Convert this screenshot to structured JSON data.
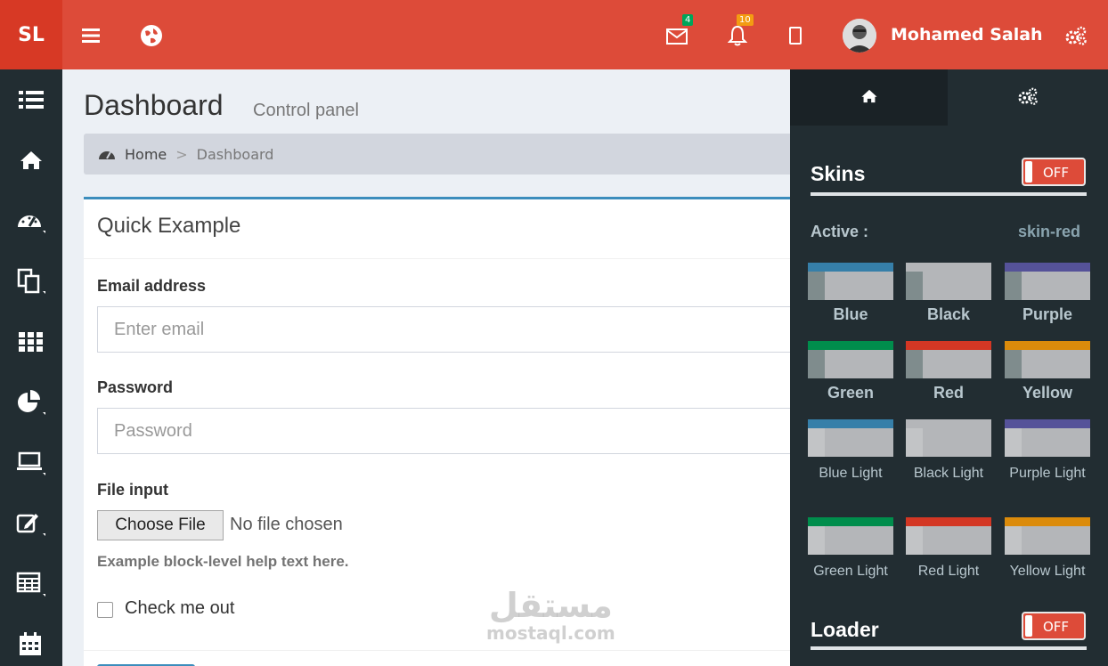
{
  "header": {
    "logo": "SL",
    "mail_count": "4",
    "notif_count": "10",
    "user_name": "Mohamed Salah"
  },
  "content": {
    "title": "Dashboard",
    "subtitle": "Control panel",
    "breadcrumb": {
      "home": "Home",
      "sep": ">",
      "current": "Dashboard"
    }
  },
  "form": {
    "box_title": "Quick Example",
    "email_label": "Email address",
    "email_placeholder": "Enter email",
    "password_label": "Password",
    "password_placeholder": "Password",
    "file_label": "File input",
    "file_button": "Choose File",
    "file_status": "No file chosen",
    "help_text": "Example block-level help text here.",
    "checkbox_label": "Check me out"
  },
  "control_sidebar": {
    "skins_heading": "Skins",
    "skins_toggle": "OFF",
    "active_label": "Active :",
    "active_value": "skin-red",
    "skins": [
      {
        "name": "Blue",
        "color": "#367fa9",
        "light": false
      },
      {
        "name": "Black",
        "color": "#b4b6b9",
        "light": false
      },
      {
        "name": "Purple",
        "color": "#555299",
        "light": false
      },
      {
        "name": "Green",
        "color": "#008d4c",
        "light": false
      },
      {
        "name": "Red",
        "color": "#d33724",
        "light": false
      },
      {
        "name": "Yellow",
        "color": "#db8b0b",
        "light": false
      },
      {
        "name": "Blue Light",
        "color": "#367fa9",
        "light": true
      },
      {
        "name": "Black Light",
        "color": "#b4b6b9",
        "light": true
      },
      {
        "name": "Purple Light",
        "color": "#555299",
        "light": true
      },
      {
        "name": "Green Light",
        "color": "#008d4c",
        "light": true
      },
      {
        "name": "Red Light",
        "color": "#d33724",
        "light": true
      },
      {
        "name": "Yellow Light",
        "color": "#db8b0b",
        "light": true
      }
    ],
    "loader_heading": "Loader",
    "loader_toggle": "OFF"
  },
  "watermark": {
    "arabic": "مستقل",
    "latin": "mostaql.com"
  },
  "colors": {
    "header": "#dd4b39",
    "logo_bg": "#d73925",
    "sidebar": "#222d32",
    "mail_badge": "#00a65a",
    "notif_badge": "#f39c12",
    "box_border": "#3c8dbc"
  },
  "icons": {
    "sidebar": [
      "list-icon",
      "home-icon",
      "dashboard-gauge-icon",
      "files-icon",
      "grid-icon",
      "pie-chart-icon",
      "laptop-icon",
      "edit-icon",
      "table-icon",
      "calendar-icon"
    ],
    "header": [
      "menu-icon",
      "globe-icon",
      "envelope-icon",
      "bell-icon",
      "mobile-icon",
      "gears-icon"
    ]
  }
}
